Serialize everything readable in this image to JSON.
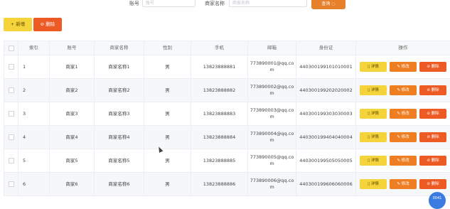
{
  "search": {
    "account_label": "账号",
    "account_placeholder": "账号",
    "merchant_label": "商家名称",
    "merchant_placeholder": "商家名称",
    "search_button": "查询 ◌"
  },
  "toolbar": {
    "add_label": "+ 新增",
    "delete_label": "⊘ 删除"
  },
  "table": {
    "headers": {
      "index": "索引",
      "account": "账号",
      "merchant": "商家名称",
      "gender": "性别",
      "phone": "手机",
      "email": "邮箱",
      "id_card": "身份证",
      "actions": "操作"
    },
    "action_labels": {
      "detail": "▯ 详情",
      "edit": "✎ 修改",
      "remove": "⊘ 删除"
    },
    "rows": [
      {
        "index": "1",
        "account": "商家1",
        "merchant": "商家名称1",
        "gender": "男",
        "phone": "13823888881",
        "email": "773890001@qq.com",
        "id_card": "440300199101010001"
      },
      {
        "index": "2",
        "account": "商家2",
        "merchant": "商家名称2",
        "gender": "男",
        "phone": "13823888882",
        "email": "773890002@qq.com",
        "id_card": "440300199202020002"
      },
      {
        "index": "3",
        "account": "商家3",
        "merchant": "商家名称3",
        "gender": "男",
        "phone": "13823888883",
        "email": "773890003@qq.com",
        "id_card": "440300199303030003"
      },
      {
        "index": "4",
        "account": "商家4",
        "merchant": "商家名称4",
        "gender": "男",
        "phone": "13823888884",
        "email": "773890004@qq.com",
        "id_card": "440300199404040004"
      },
      {
        "index": "5",
        "account": "商家5",
        "merchant": "商家名称5",
        "gender": "男",
        "phone": "13823888885",
        "email": "773890005@qq.com",
        "id_card": "440300199505050005"
      },
      {
        "index": "6",
        "account": "商家6",
        "merchant": "商家名称6",
        "gender": "男",
        "phone": "13823888886",
        "email": "773890006@qq.com",
        "id_card": "440300199606060006"
      }
    ]
  },
  "floating_badge": "0041",
  "colors": {
    "primary_yellow": "#f5d33a",
    "accent_orange": "#ef7d22",
    "danger_red": "#ee5a24",
    "badge_blue": "#3a7be0"
  }
}
